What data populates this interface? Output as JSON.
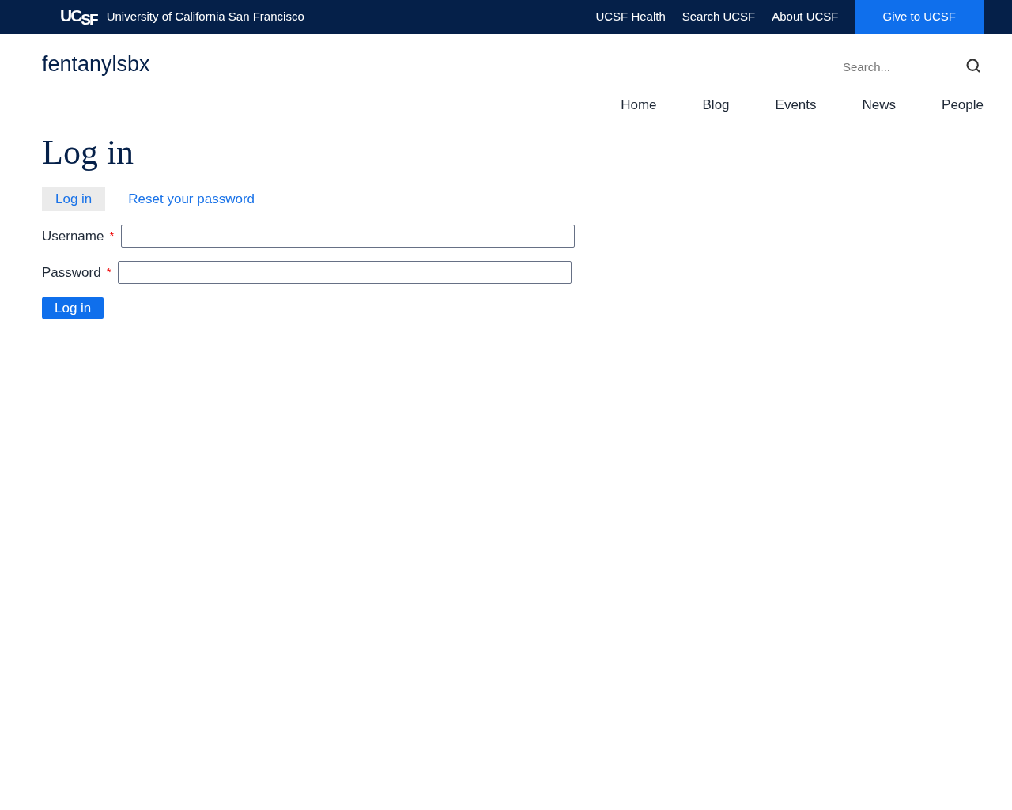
{
  "top_bar": {
    "logo": {
      "upper": "UC",
      "lower": "SF"
    },
    "university": "University of California San Francisco",
    "links": [
      {
        "label": "UCSF Health",
        "kind": "link"
      },
      {
        "label": "Search UCSF",
        "kind": "link"
      },
      {
        "label": "About UCSF",
        "kind": "link"
      },
      {
        "label": "Give to UCSF",
        "kind": "cta"
      }
    ]
  },
  "site": {
    "name": "fentanylsbx",
    "search": {
      "placeholder": "Search..."
    }
  },
  "nav": [
    "Home",
    "Blog",
    "Events",
    "News",
    "People"
  ],
  "page_title": "Log in",
  "tabs": [
    {
      "label": "Log in",
      "selected": true
    },
    {
      "label": "Reset your password",
      "selected": false
    }
  ],
  "fields": [
    {
      "label": "Username",
      "required": true,
      "mark": "*"
    },
    {
      "label": "Password",
      "required": true,
      "mark": "*"
    }
  ],
  "submit": "Log in"
}
